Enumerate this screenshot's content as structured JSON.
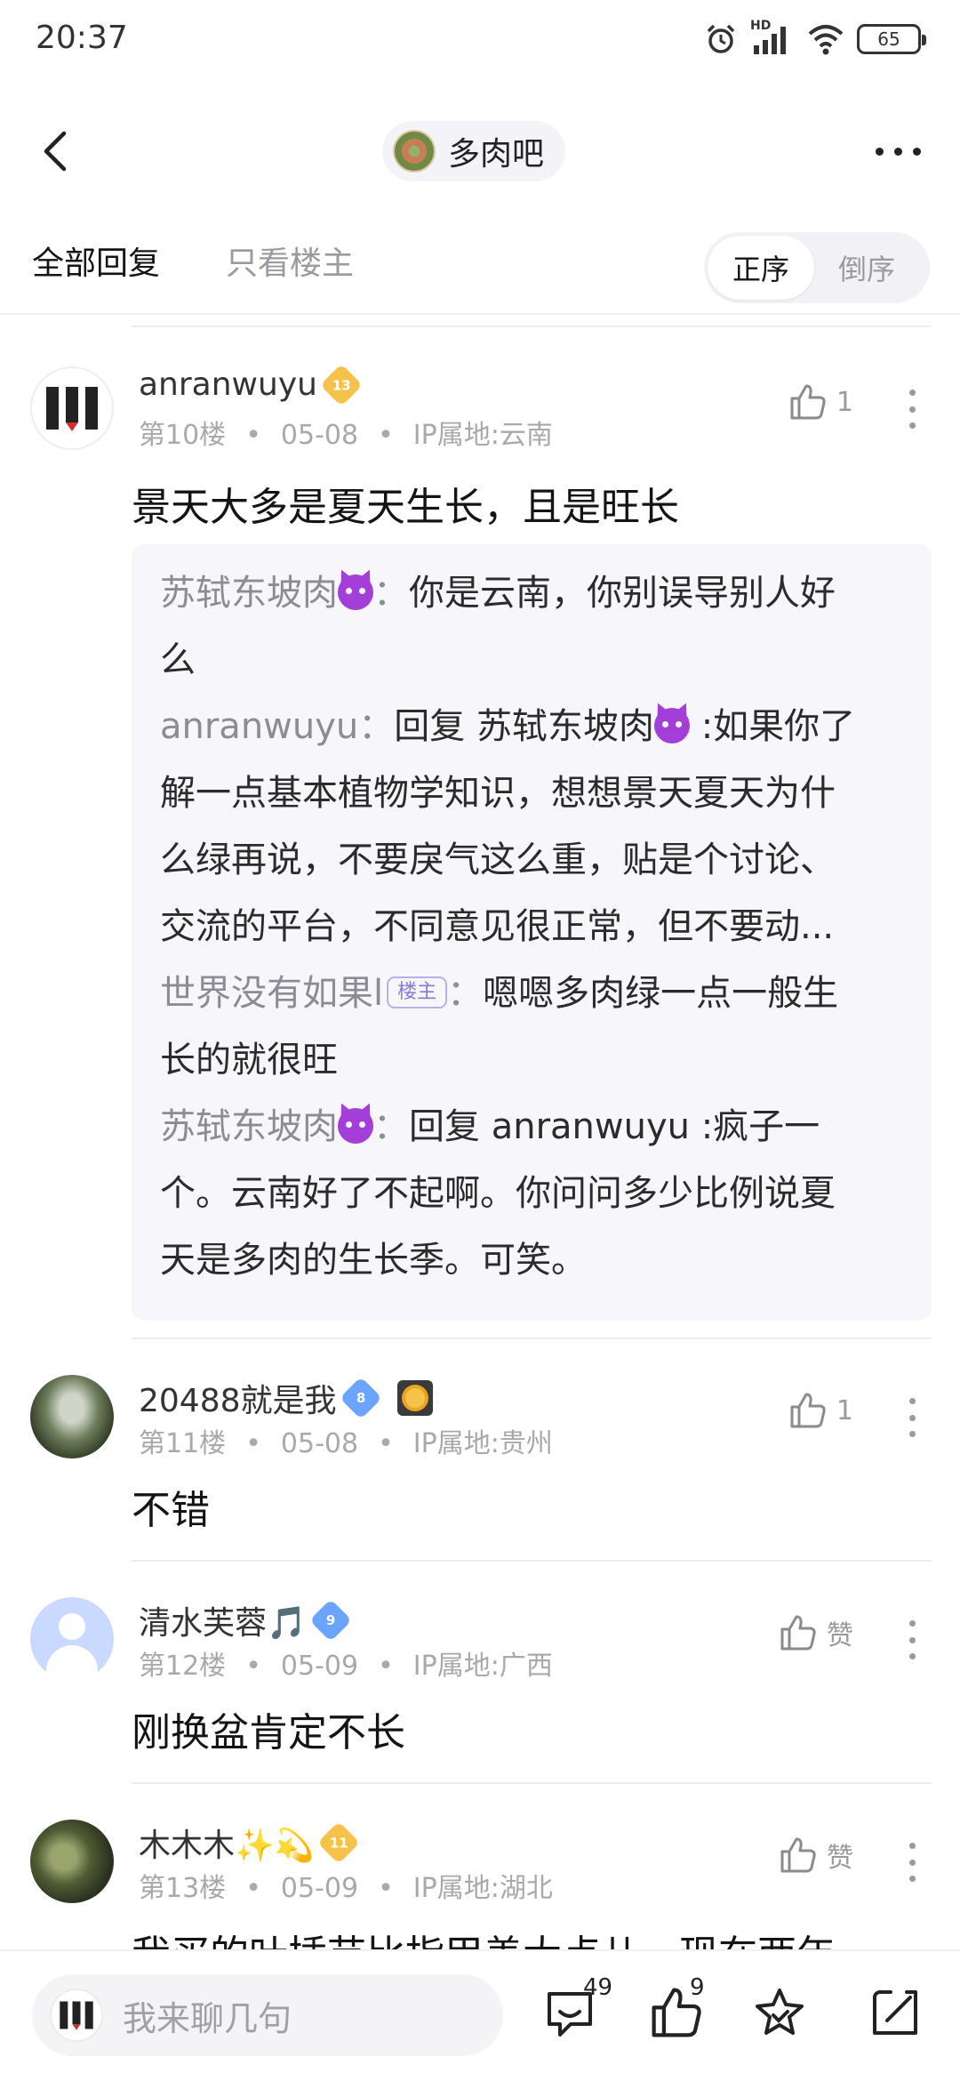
{
  "status_bar": {
    "time": "20:37",
    "battery": "65",
    "network": "HD"
  },
  "nav": {
    "forum_name": "多肉吧"
  },
  "tabs": {
    "all": "全部回复",
    "op_only": "只看楼主",
    "order_asc": "正序",
    "order_desc": "倒序"
  },
  "posts": [
    {
      "username": "anranwuyu",
      "level": "13",
      "floor": "第10楼",
      "date": "05-08",
      "ip": "IP属地:云南",
      "likes": "1",
      "content": "景天大多是夏天生长，且是旺长",
      "replies": [
        {
          "name": "苏轼东坡肉",
          "sep": "：",
          "l1": "你是云南，你别误导别人好",
          "l2": "么"
        },
        {
          "name": "anranwuyu",
          "sep": "：",
          "l1a": "回复 苏轼东坡肉",
          "l1b": " :如果你了",
          "l2": "解一点基本植物学知识，想想景天夏天为什",
          "l3": "么绿再说，不要戾气这么重，贴是个讨论、",
          "l4": "交流的平台，不同意见很正常，但不要动..."
        },
        {
          "name": "世界没有如果l",
          "tag": "楼主",
          "sep": "：",
          "l1": "嗯嗯多肉绿一点一般生",
          "l2": "长的就很旺"
        },
        {
          "name": "苏轼东坡肉",
          "sep": "：",
          "l1": "回复 anranwuyu :疯子一",
          "l2": "个。云南好了不起啊。你问问多少比例说夏",
          "l3": "天是多肉的生长季。可笑。"
        }
      ]
    },
    {
      "username": "20488就是我",
      "level": "8",
      "floor": "第11楼",
      "date": "05-08",
      "ip": "IP属地:贵州",
      "likes": "1",
      "content": "不错"
    },
    {
      "username": "清水芙蓉🎵",
      "level": "9",
      "floor": "第12楼",
      "date": "05-09",
      "ip": "IP属地:广西",
      "like_label": "赞",
      "content": "刚换盆肯定不长"
    },
    {
      "username": "木木木✨💫",
      "level": "11",
      "floor": "第13楼",
      "date": "05-09",
      "ip": "IP属地:湖北",
      "like_label": "赞",
      "content": "我买的叶插苗比指甲盖大点儿，现在两年"
    }
  ],
  "bottom_bar": {
    "placeholder": "我来聊几句",
    "comment_count": "49",
    "like_count": "9"
  }
}
